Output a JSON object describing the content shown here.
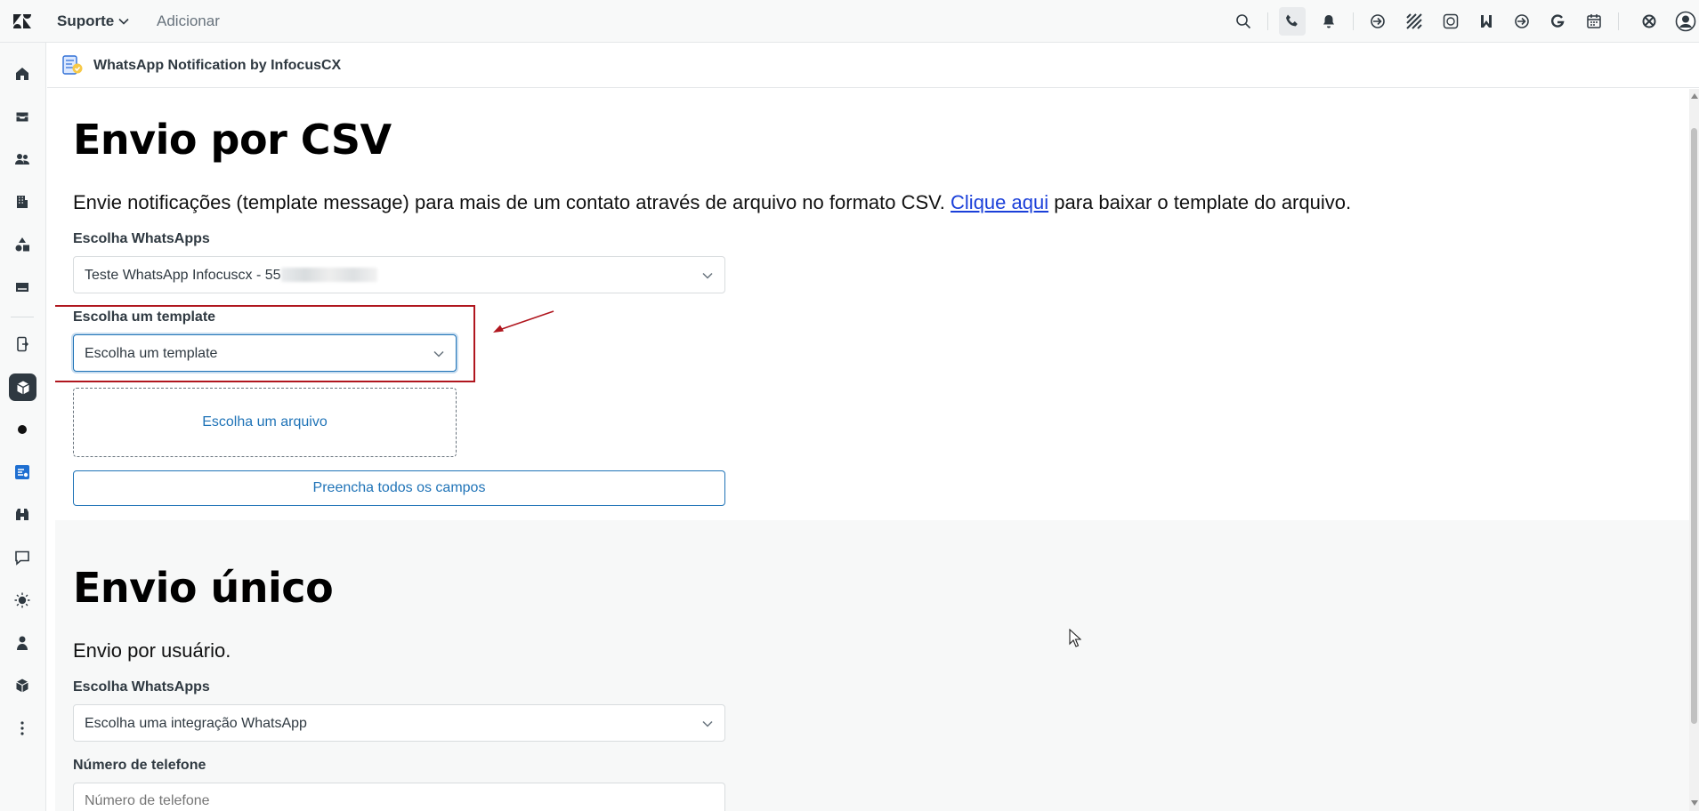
{
  "topbar": {
    "brand": "Suporte",
    "add": "Adicionar",
    "icons": [
      "zendesk-logo-icon",
      "chevron-down-icon",
      "search-icon",
      "phone-icon",
      "bell-icon",
      "arrow-circle-icon",
      "grid-pattern-icon",
      "whatsapp-icon",
      "bookmark-icon",
      "arrow-circle-icon",
      "g-icon",
      "calendar-icon",
      "apps-icon",
      "user-avatar-icon"
    ]
  },
  "rail": {
    "icons": [
      "home-icon",
      "inbox-icon",
      "users-icon",
      "building-icon",
      "shapes-icon",
      "monitor-icon",
      "device-icon",
      "cube-icon",
      "dot-icon",
      "app-blue-icon",
      "binoculars-icon",
      "chat-icon",
      "sun-icon",
      "person-icon",
      "box-icon",
      "more-icon"
    ]
  },
  "app": {
    "title": "WhatsApp Notification by InfocusCX"
  },
  "csv_section": {
    "heading": "Envio por CSV",
    "description_before": "Envie notificações (template message) para mais de um contato através de arquivo no formato CSV. ",
    "link_text": "Clique aqui",
    "description_after": " para baixar o template do arquivo.",
    "whatsapp_label": "Escolha WhatsApps",
    "whatsapp_value": "Teste WhatsApp Infocuscx - 55",
    "template_label": "Escolha um template",
    "template_value": "Escolha um template",
    "file_label": "Escolha um arquivo",
    "submit_label": "Preencha todos os campos"
  },
  "single_section": {
    "heading": "Envio único",
    "description": "Envio por usuário.",
    "whatsapp_label": "Escolha WhatsApps",
    "whatsapp_value": "Escolha uma integração WhatsApp",
    "phone_label": "Número de telefone",
    "phone_placeholder": "Número de telefone"
  },
  "colors": {
    "annotation": "#b0161e",
    "accent": "#1f73b7",
    "link": "#1a3fd9"
  }
}
